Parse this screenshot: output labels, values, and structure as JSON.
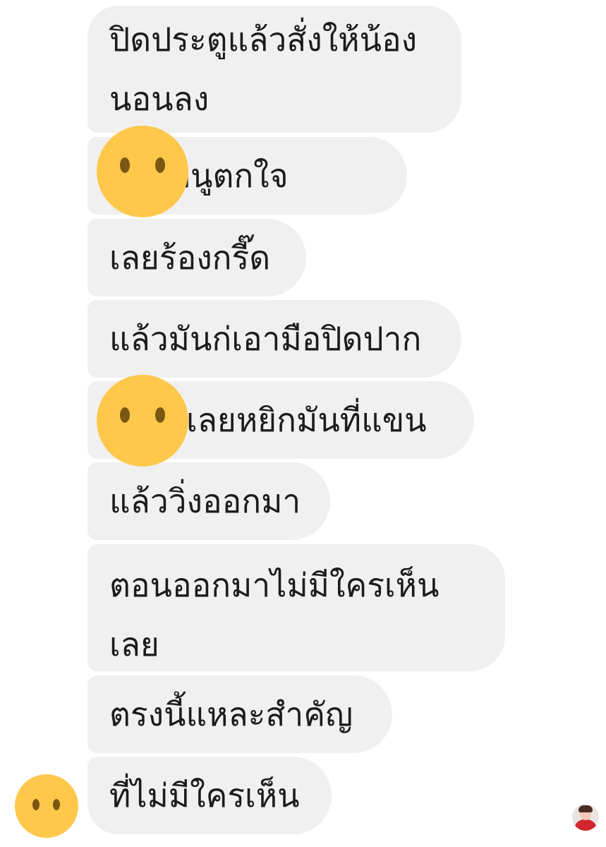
{
  "conversation": {
    "messages": [
      {
        "lines": [
          "ปิดประตูแล้วสั่งให้น้อง",
          "นอนลง"
        ]
      },
      {
        "lines": [
          "บอกหนูตกใจ"
        ]
      },
      {
        "lines": [
          "เลยร้องกรี๊ด"
        ]
      },
      {
        "lines": [
          "แล้วมันก่เอามือปิดปาก"
        ]
      },
      {
        "lines": [
          "เลยหยิกมันที่แขน"
        ]
      },
      {
        "lines": [
          "แล้ววิ่งออกมา"
        ]
      },
      {
        "lines": [
          "ตอนออกมาไม่มีใครเห็น",
          "เลย"
        ]
      },
      {
        "lines": [
          "ตรงนี้แหละสำคัญ"
        ]
      },
      {
        "lines": [
          "ที่ไม่มีใครเห็น"
        ]
      }
    ]
  },
  "colors": {
    "bubble": "#f0f0f0",
    "text": "#1c1c1c",
    "sticker": "#ffc84b",
    "sticker_eyes": "#7a5712"
  },
  "icons": {
    "censor_sticker": "yellow-face-sticker-icon",
    "sender_avatar": "user-avatar-icon",
    "read_receipt": "read-receipt-avatar-icon"
  }
}
